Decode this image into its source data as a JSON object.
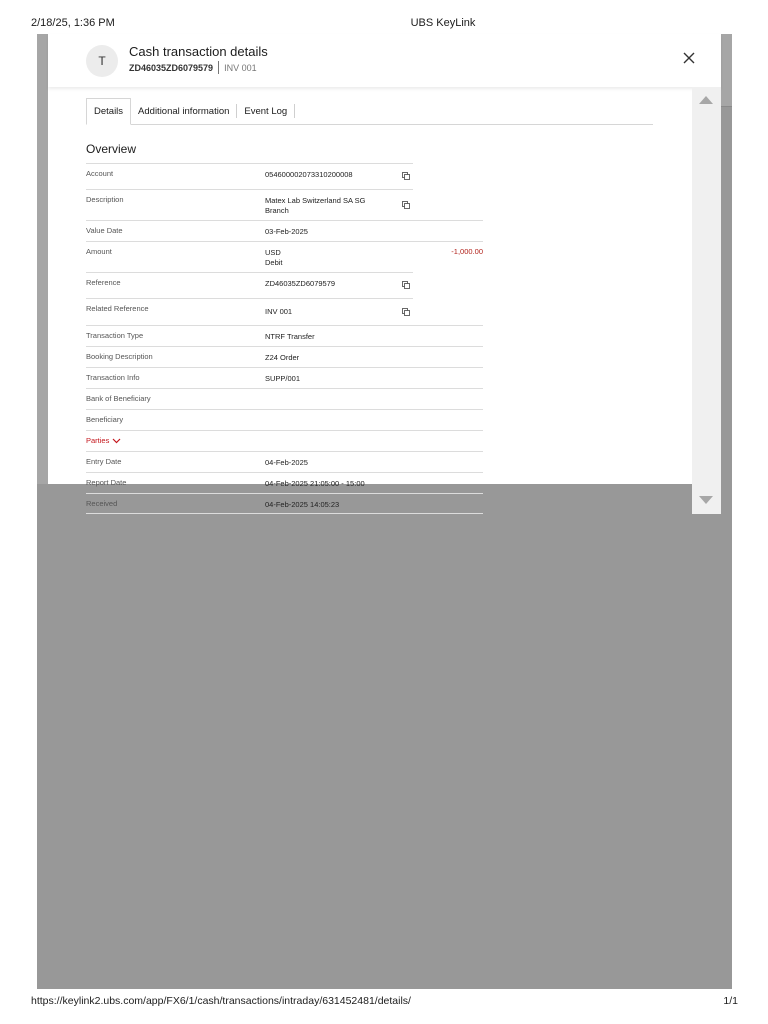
{
  "print_header": {
    "datetime": "2/18/25, 1:36 PM",
    "title": "UBS KeyLink"
  },
  "print_footer": {
    "url": "https://keylink2.ubs.com/app/FX6/1/cash/transactions/intraday/631452481/details/",
    "page": "1/1"
  },
  "modal": {
    "avatar_initial": "T",
    "title": "Cash transaction details",
    "reference": "ZD46035ZD6079579",
    "invoice": "INV 001",
    "tabs": [
      {
        "label": "Details",
        "active": true
      },
      {
        "label": "Additional information",
        "active": false
      },
      {
        "label": "Event Log",
        "active": false
      }
    ],
    "overview_title": "Overview",
    "rows": [
      {
        "label": "Account",
        "value": "054600002073310200008",
        "copy": true
      },
      {
        "label": "Description",
        "value": "Matex Lab Switzerland SA SG",
        "value2": "Branch",
        "copy": true
      },
      {
        "label": "Value Date",
        "value": "03-Feb-2025"
      },
      {
        "label": "Amount",
        "value": "USD",
        "value2": "Debit",
        "amount": "-1,000.00"
      },
      {
        "label": "Reference",
        "value": "ZD46035ZD6079579",
        "copy": true
      },
      {
        "label": "Related Reference",
        "value": "INV 001",
        "copy": true
      },
      {
        "label": "Transaction Type",
        "value": "NTRF Transfer"
      },
      {
        "label": "Booking Description",
        "value": "Z24 Order"
      },
      {
        "label": "Transaction Info",
        "value": "SUPP/001"
      },
      {
        "label": "Bank of Beneficiary",
        "value": ""
      },
      {
        "label": "Beneficiary",
        "value": ""
      },
      {
        "label": "Parties",
        "value": "",
        "toggle": true
      },
      {
        "label": "Entry Date",
        "value": "04-Feb-2025"
      },
      {
        "label": "Report Date",
        "value": "04-Feb-2025 21:05:00 - 15:00"
      },
      {
        "label": "Received",
        "value": "04-Feb-2025 14:05:23"
      }
    ]
  },
  "colors": {
    "backdrop": "#989898",
    "amount_negative": "#b2221b",
    "parties_link": "#c4161c"
  }
}
